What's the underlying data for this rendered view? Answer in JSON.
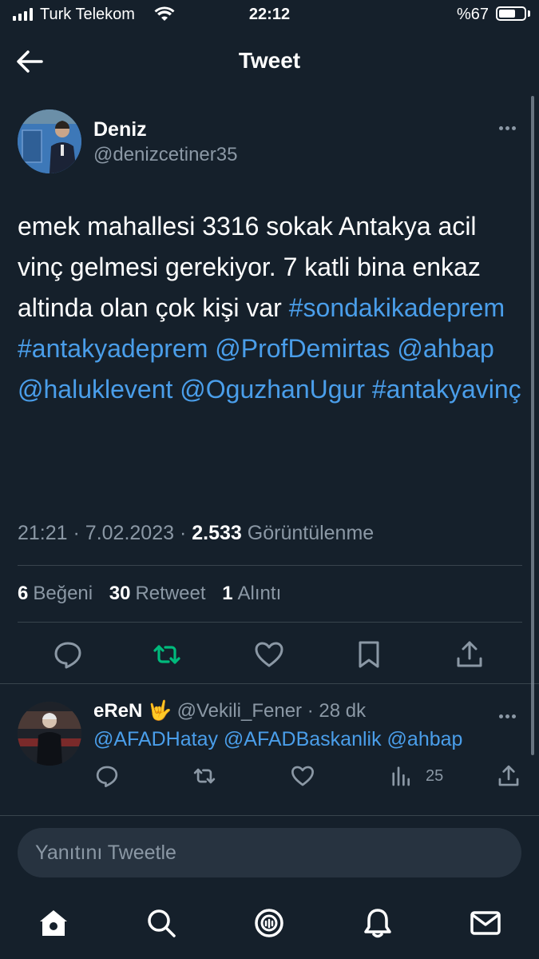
{
  "status_bar": {
    "carrier": "Turk Telekom",
    "time": "22:12",
    "battery_percent_label": "%67",
    "battery_level": 0.67
  },
  "header": {
    "title": "Tweet"
  },
  "tweet": {
    "author_name": "Deniz",
    "author_handle": "@denizcetiner35",
    "text_plain": "emek mahallesi 3316 sokak Antakya acil vinç gelmesi gerekiyor.  7 katli bina enkaz altinda olan çok kişi var",
    "hashtag_1": "#sondakikadeprem",
    "hashtag_2": "#antakyadeprem",
    "mention_1": "@ProfDemirtas",
    "mention_2": "@ahbap",
    "mention_3": "@haluklevent",
    "mention_4": "@OguzhanUgur",
    "hashtag_3": "#antakyavinç",
    "time": "21:21",
    "date": "7.02.2023",
    "views": "2.533",
    "views_label": "Görüntülenme",
    "likes": "6",
    "likes_label": "Beğeni",
    "retweets": "30",
    "retweets_label": "Retweet",
    "quotes": "1",
    "quotes_label": "Alıntı"
  },
  "reply": {
    "author_name": "eReN",
    "emoji": "🤟",
    "author_handle": "@Vekili_Fener",
    "age": "28 dk",
    "text": "@AFADHatay @AFADBaskanlik @ahbap",
    "views": "25"
  },
  "reply_input": {
    "placeholder": "Yanıtını Tweetle"
  },
  "colors": {
    "background": "#15202b",
    "accent": "#4a9eea",
    "secondary": "#8b98a5",
    "retweet_active": "#00ba7c"
  },
  "icons": [
    "back-arrow-icon",
    "more-icon",
    "reply-icon",
    "retweet-icon",
    "like-icon",
    "bookmark-icon",
    "share-icon",
    "views-icon",
    "home-icon",
    "search-icon",
    "spaces-icon",
    "notifications-icon",
    "messages-icon"
  ]
}
